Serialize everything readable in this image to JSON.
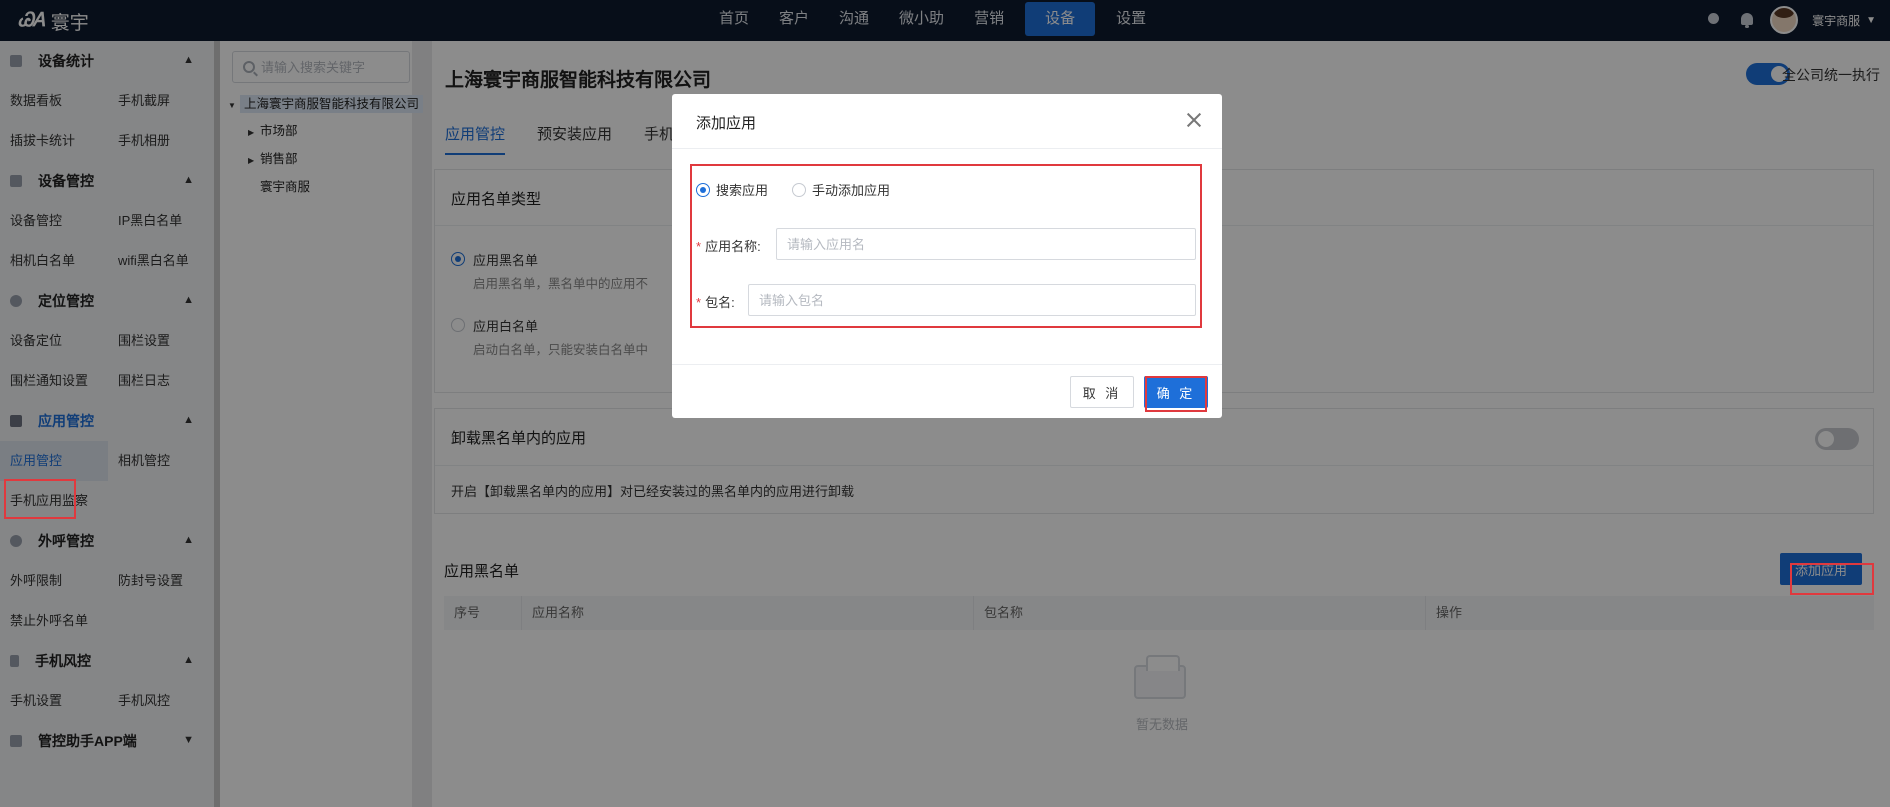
{
  "topbar": {
    "logo_mark": "ᏊᎪ",
    "logo_text": "寰宇",
    "nav": [
      "首页",
      "客户",
      "沟通",
      "微小助",
      "营销",
      "设备",
      "设置"
    ],
    "active_nav": 5,
    "user_name": "寰宇商服"
  },
  "sidebar": {
    "sections": [
      {
        "title": "设备统计",
        "items": [
          "数据看板",
          "手机截屏",
          "插拔卡统计",
          "手机相册"
        ]
      },
      {
        "title": "设备管控",
        "items": [
          "设备管控",
          "IP黑白名单",
          "相机白名单",
          "wifi黑白名单"
        ]
      },
      {
        "title": "定位管控",
        "items": [
          "设备定位",
          "围栏设置",
          "围栏通知设置",
          "围栏日志"
        ]
      },
      {
        "title": "应用管控",
        "items": [
          "应用管控",
          "相机管控",
          "手机应用监察"
        ]
      },
      {
        "title": "外呼管控",
        "items": [
          "外呼限制",
          "防封号设置",
          "禁止外呼名单"
        ]
      },
      {
        "title": "手机风控",
        "items": [
          "手机设置",
          "手机风控"
        ]
      },
      {
        "title": "管控助手APP端",
        "items": []
      }
    ]
  },
  "tree": {
    "search_placeholder": "请输入搜索关键字",
    "root": "上海寰宇商服智能科技有限公司",
    "children": [
      "市场部",
      "销售部",
      "寰宇商服"
    ]
  },
  "main": {
    "company": "上海寰宇商服智能科技有限公司",
    "unify_label": "全公司统一执行",
    "tabs": [
      "应用管控",
      "预安装应用",
      "手机"
    ],
    "list_type": {
      "title": "应用名单类型",
      "black_label": "应用黑名单",
      "black_desc": "启用黑名单，黑名单中的应用不",
      "white_label": "应用白名单",
      "white_desc": "启动白名单，只能安装白名单中"
    },
    "uninstall": {
      "title": "卸载黑名单内的应用",
      "desc": "开启【卸载黑名单内的应用】对已经安装过的黑名单内的应用进行卸载"
    },
    "blacklist": {
      "title": "应用黑名单",
      "add_button": "添加应用",
      "columns": [
        "序号",
        "应用名称",
        "包名称",
        "操作"
      ],
      "empty": "暂无数据"
    }
  },
  "modal": {
    "title": "添加应用",
    "radio_search": "搜索应用",
    "radio_manual": "手动添加应用",
    "app_name_label": "应用名称:",
    "app_name_placeholder": "请输入应用名",
    "package_label": "包名:",
    "package_placeholder": "请输入包名",
    "cancel": "取 消",
    "ok": "确 定"
  }
}
